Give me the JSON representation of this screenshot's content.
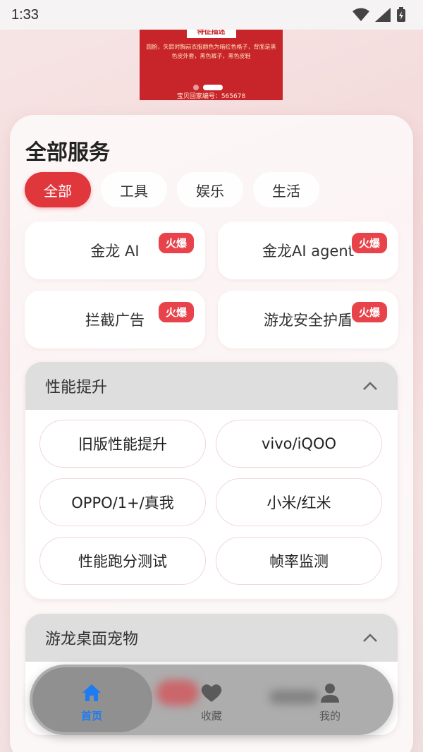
{
  "status": {
    "time": "1:33"
  },
  "banner": {
    "heading": "特征描述",
    "description": "圆脸，失踪时胸前衣服颜色为暗红色格子，背面是黑色皮外套，黑色裤子，黑色皮鞋",
    "id_text": "宝贝回家编号：565678"
  },
  "services": {
    "title": "全部服务",
    "chips": [
      {
        "label": "全部",
        "active": true
      },
      {
        "label": "工具",
        "active": false
      },
      {
        "label": "娱乐",
        "active": false
      },
      {
        "label": "生活",
        "active": false
      }
    ],
    "items": [
      {
        "label": "金龙 AI",
        "badge": "火爆"
      },
      {
        "label": "金龙AI agent",
        "badge": "火爆"
      },
      {
        "label": "拦截广告",
        "badge": "火爆"
      },
      {
        "label": "游龙安全护盾",
        "badge": "火爆"
      }
    ]
  },
  "performance": {
    "title": "性能提升",
    "options": [
      "旧版性能提升",
      "vivo/iQOO",
      "OPPO/1+/真我",
      "小米/红米",
      "性能跑分测试",
      "帧率监测"
    ]
  },
  "pets": {
    "title": "游龙桌面宠物"
  },
  "nav": {
    "items": [
      {
        "label": "首页",
        "icon": "home-icon",
        "active": true
      },
      {
        "label": "收藏",
        "icon": "heart-icon",
        "active": false
      },
      {
        "label": "我的",
        "icon": "user-icon",
        "active": false
      }
    ]
  },
  "colors": {
    "accent": "#e0373d",
    "nav_active": "#1d7cf2",
    "banner_bg": "#c8252a"
  }
}
